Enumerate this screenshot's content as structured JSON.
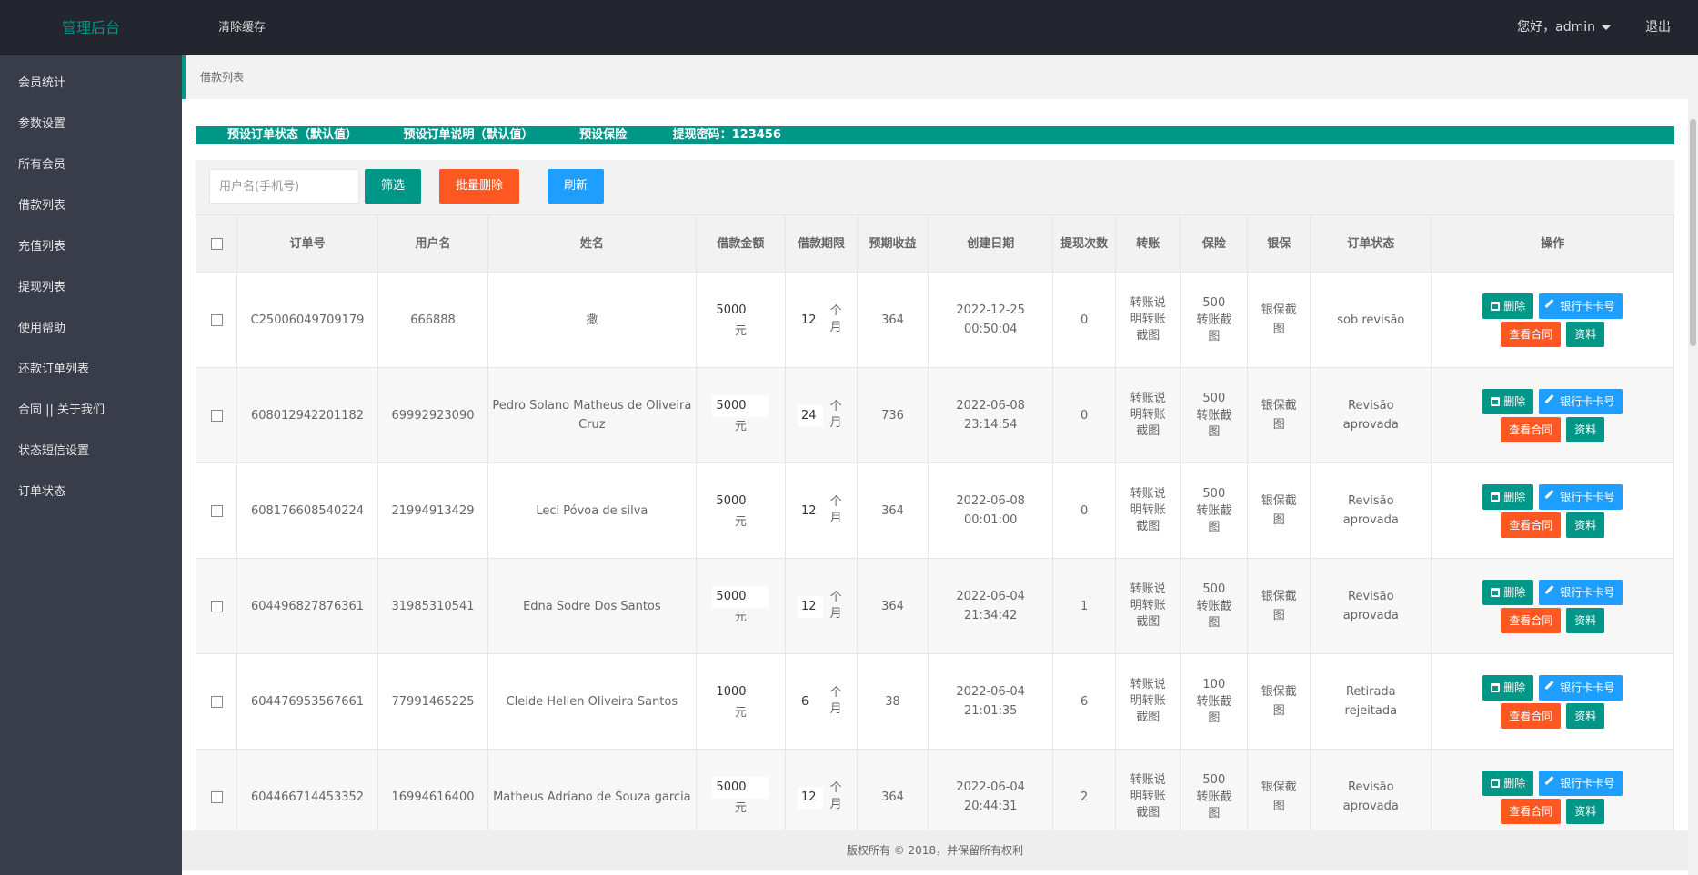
{
  "header": {
    "logo": "管理后台",
    "clear_cache": "清除缓存",
    "greeting": "您好，admin",
    "logout": "退出"
  },
  "sidebar": {
    "items": [
      {
        "label": "会员统计"
      },
      {
        "label": "参数设置"
      },
      {
        "label": "所有会员"
      },
      {
        "label": "借款列表"
      },
      {
        "label": "充值列表"
      },
      {
        "label": "提现列表"
      },
      {
        "label": "使用帮助"
      },
      {
        "label": "还款订单列表"
      },
      {
        "label": "合同 || 关于我们"
      },
      {
        "label": "状态短信设置"
      },
      {
        "label": "订单状态"
      }
    ]
  },
  "breadcrumb": "借款列表",
  "notice": {
    "item1": "预设订单状态（默认值）",
    "item2": "预设订单说明（默认值）",
    "item3": "预设保险",
    "item4": "提现密码：123456"
  },
  "toolbar": {
    "search_placeholder": "用户名(手机号)",
    "filter": "筛选",
    "batch_delete": "批量删除",
    "refresh": "刷新"
  },
  "table": {
    "headers": {
      "order_no": "订单号",
      "username": "用户名",
      "name": "姓名",
      "amount": "借款金额",
      "term": "借款期限",
      "income": "预期收益",
      "created": "创建日期",
      "withdraw_count": "提现次数",
      "transfer": "转账",
      "insurance": "保险",
      "bank_guarantee": "银保",
      "status": "订单状态",
      "actions": "操作"
    },
    "labels": {
      "yuan": "元",
      "month": "个月",
      "transfer_text": "转账说明转账截图",
      "insurance_suffix": "转账截图",
      "bank_guarantee_text": "银保截图",
      "delete": "删除",
      "bank_card": "银行卡卡号",
      "view_contract": "查看合同",
      "info": "资料"
    },
    "rows": [
      {
        "order_no": "C25006049709179",
        "username": "666888",
        "name": "撒",
        "amount": "5000",
        "term": "12",
        "income": "364",
        "created": "2022-12-25 00:50:04",
        "withdraw_count": "0",
        "insurance": "500",
        "status": "sob revisão"
      },
      {
        "order_no": "608012942201182",
        "username": "69992923090",
        "name": "Pedro Solano Matheus de Oliveira Cruz",
        "amount": "5000",
        "term": "24",
        "income": "736",
        "created": "2022-06-08 23:14:54",
        "withdraw_count": "0",
        "insurance": "500",
        "status": "Revisão aprovada"
      },
      {
        "order_no": "608176608540224",
        "username": "21994913429",
        "name": "Leci Póvoa de silva",
        "amount": "5000",
        "term": "12",
        "income": "364",
        "created": "2022-06-08 00:01:00",
        "withdraw_count": "0",
        "insurance": "500",
        "status": "Revisão aprovada"
      },
      {
        "order_no": "604496827876361",
        "username": "31985310541",
        "name": "Edna Sodre Dos Santos",
        "amount": "5000",
        "term": "12",
        "income": "364",
        "created": "2022-06-04 21:34:42",
        "withdraw_count": "1",
        "insurance": "500",
        "status": "Revisão aprovada"
      },
      {
        "order_no": "604476953567661",
        "username": "77991465225",
        "name": "Cleide Hellen Oliveira Santos",
        "amount": "1000",
        "term": "6",
        "income": "38",
        "created": "2022-06-04 21:01:35",
        "withdraw_count": "6",
        "insurance": "100",
        "status": "Retirada rejeitada"
      },
      {
        "order_no": "604466714453352",
        "username": "16994616400",
        "name": "Matheus Adriano de Souza garcia",
        "amount": "5000",
        "term": "12",
        "income": "364",
        "created": "2022-06-04 20:44:31",
        "withdraw_count": "2",
        "insurance": "500",
        "status": "Revisão aprovada"
      }
    ]
  },
  "footer": "版权所有 © 2018，并保留所有权利"
}
